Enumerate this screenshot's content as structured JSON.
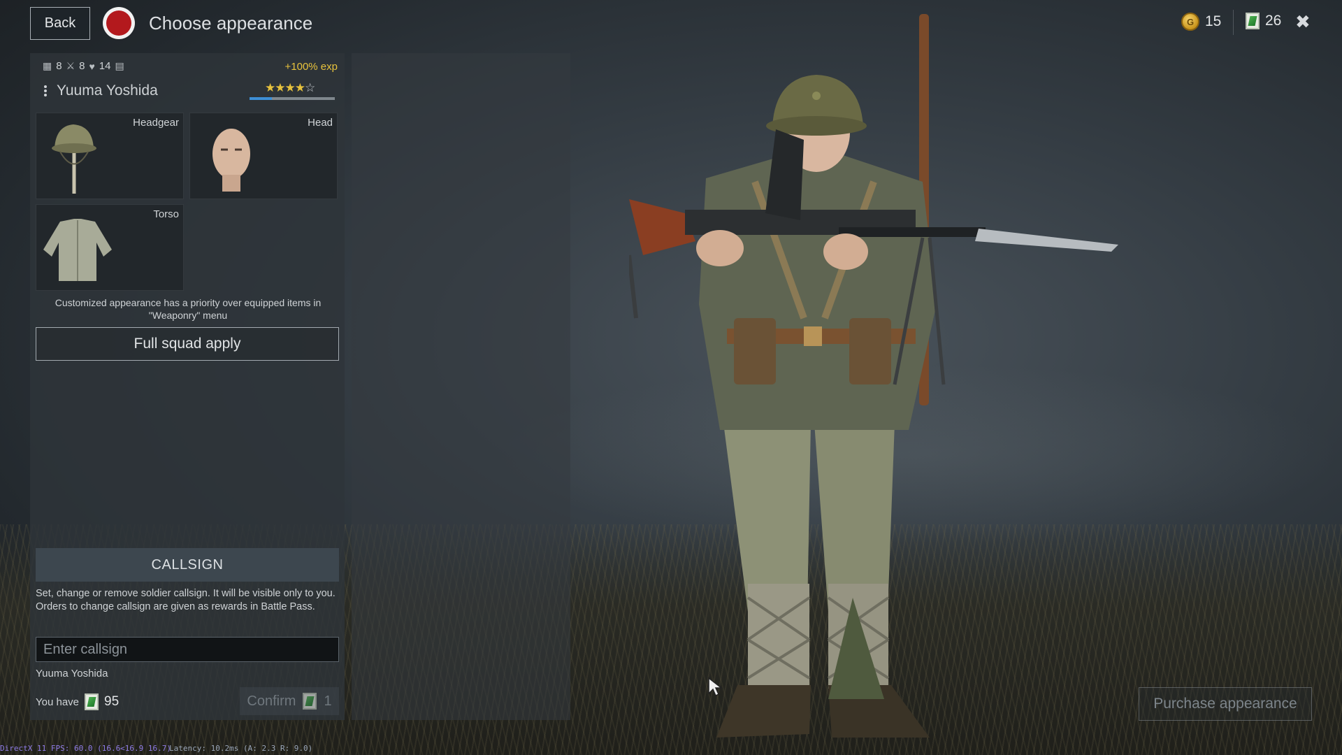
{
  "header": {
    "back_label": "Back",
    "title": "Choose appearance",
    "gold": "15",
    "tickets": "26",
    "close_glyph": "✖"
  },
  "soldier": {
    "stats": [
      "8",
      "8",
      "14"
    ],
    "exp_bonus": "+100% exp",
    "name": "Yuuma Yoshida",
    "stars_filled": "★★★★",
    "stars_empty": "☆",
    "xp_progress": 0.26
  },
  "slots": [
    {
      "label": "Headgear",
      "icon": "helmet-icon"
    },
    {
      "label": "Head",
      "icon": "head-icon"
    },
    {
      "label": "Torso",
      "icon": "tunic-icon"
    }
  ],
  "note_line1": "Customized appearance has a priority over equipped items in",
  "note_line2": "\"Weaponry\" menu",
  "squad_apply_label": "Full squad apply",
  "callsign": {
    "heading": "CALLSIGN",
    "description": "Set, change or remove soldier callsign. It will be visible only to you. Orders to change callsign are given as rewards in Battle Pass.",
    "placeholder": "Enter callsign",
    "current": "Yuuma Yoshida",
    "you_have_label": "You have",
    "you_have_amount": "95",
    "confirm_label": "Confirm",
    "confirm_cost": "1"
  },
  "purchase_label": "Purchase appearance",
  "debug": {
    "fps": "DirectX 11 FPS: 60.0 (16.6<16.9 16.7)",
    "latency": "Latency: 10.2ms (A: 2.3 R: 9.0)"
  },
  "colors": {
    "accent_gold": "#e7c23d",
    "faction_red": "#b3191d",
    "xp_blue": "#3d8fd6"
  }
}
